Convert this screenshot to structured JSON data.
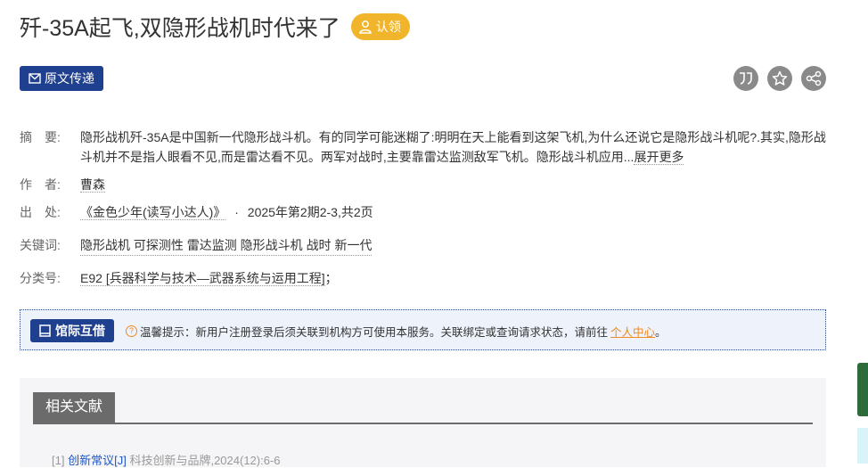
{
  "article": {
    "title": "歼-35A起飞,双隐形战机时代来了",
    "claim_label": "认领",
    "original_button": "原文传递"
  },
  "actions": {
    "icons": [
      "quote-icon",
      "star-icon",
      "share-icon"
    ]
  },
  "meta": {
    "abstract_label": "摘　要:",
    "abstract_line1": "隐形战机歼-35A是中国新一代隐形战斗机。有的同学可能迷糊了:明明在天上能看到这架飞机,为什么还说它是隐形战斗机呢?.其实,隐形战",
    "abstract_line2": "斗机并不是指人眼看不见,而是雷达看不见。两军对战时,主要靠雷达监测敌军飞机。隐形战斗机应用...",
    "expand_more": "展开更多",
    "author_label": "作　者:",
    "author": "曹森",
    "source_label": "出　处:",
    "source_journal": "《金色少年(读写小达人)》",
    "source_sep": "·",
    "source_issue": "2025年第2期2-3,共2页",
    "keywords_label": "关键词:",
    "keywords": [
      "隐形战机",
      "可探测性",
      "雷达监测",
      "隐形战斗机",
      "战时",
      "新一代"
    ],
    "class_label": "分类号:",
    "class_code": "E92",
    "class_desc": "[兵器科学与技术—武器系统与运用工程]",
    "class_suffix": "；"
  },
  "ill": {
    "button": "馆际互借",
    "tip_prefix": "温馨提示：新用户注册登录后须关联到机构方可使用本服务。关联绑定或查询请求状态，请前往",
    "tip_link": "个人中心",
    "tip_suffix": "。"
  },
  "related": {
    "tab": "相关文献",
    "item1_index": "[1]",
    "item1_title": "创新常议[J]",
    "item1_source": "科技创新与品牌,2024(12):6-6"
  },
  "colors": {
    "brand_blue": "#1f3f8f",
    "badge_gold": "#f0b52b",
    "tip_orange": "#f08a24"
  }
}
